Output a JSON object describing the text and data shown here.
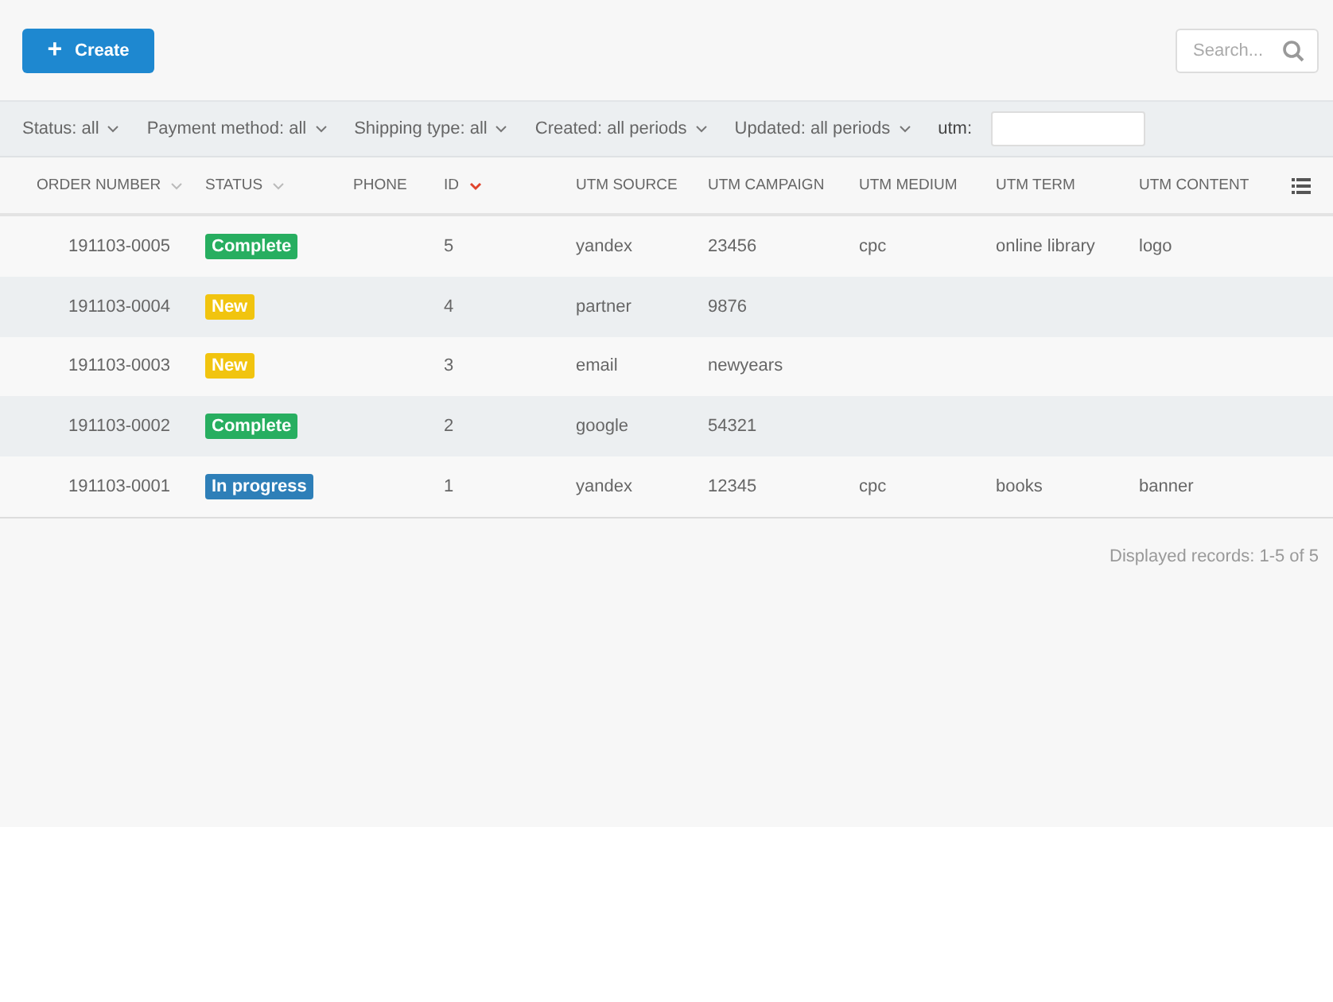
{
  "toolbar": {
    "create_button": {
      "icon": "+",
      "label": "Create"
    },
    "search": {
      "placeholder": "Search..."
    }
  },
  "filters": [
    {
      "label": "Status:",
      "value": "all",
      "kind": "dropdown"
    },
    {
      "label": "Payment method:",
      "value": "all",
      "kind": "dropdown"
    },
    {
      "label": "Shipping type:",
      "value": "all",
      "kind": "dropdown"
    },
    {
      "label": "Created:",
      "value": "all periods",
      "kind": "dropdown"
    },
    {
      "label": "Updated:",
      "value": "all periods",
      "kind": "dropdown"
    },
    {
      "label": "utm:",
      "kind": "input"
    }
  ],
  "table": {
    "columns": [
      {
        "label": "ORDER NUMBER",
        "kind": "sortable",
        "sorted": false
      },
      {
        "label": "STATUS",
        "kind": "sortable",
        "sorted": false
      },
      {
        "label": "PHONE",
        "kind": "plain"
      },
      {
        "label": "ID",
        "kind": "sortable",
        "sorted": true
      },
      {
        "label": "UTM SOURCE",
        "kind": "plain"
      },
      {
        "label": "UTM CAMPAIGN",
        "kind": "plain"
      },
      {
        "label": "UTM MEDIUM",
        "kind": "plain"
      },
      {
        "label": "UTM TERM",
        "kind": "plain"
      },
      {
        "label": "UTM CONTENT",
        "kind": "plain"
      }
    ],
    "rows": [
      {
        "order_number": "191103-0005",
        "status": {
          "label": "Complete",
          "color": "#27ae60"
        },
        "phone": "",
        "id": "5",
        "utm_source": "yandex",
        "utm_campaign": "23456",
        "utm_medium": "cpc",
        "utm_term": "online library",
        "utm_content": "logo"
      },
      {
        "order_number": "191103-0004",
        "status": {
          "label": "New",
          "color": "#f1c40f"
        },
        "phone": "",
        "id": "4",
        "utm_source": "partner",
        "utm_campaign": "9876",
        "utm_medium": "",
        "utm_term": "",
        "utm_content": ""
      },
      {
        "order_number": "191103-0003",
        "status": {
          "label": "New",
          "color": "#f1c40f"
        },
        "phone": "",
        "id": "3",
        "utm_source": "email",
        "utm_campaign": "newyears",
        "utm_medium": "",
        "utm_term": "",
        "utm_content": ""
      },
      {
        "order_number": "191103-0002",
        "status": {
          "label": "Complete",
          "color": "#27ae60"
        },
        "phone": "",
        "id": "2",
        "utm_source": "google",
        "utm_campaign": "54321",
        "utm_medium": "",
        "utm_term": "",
        "utm_content": ""
      },
      {
        "order_number": "191103-0001",
        "status": {
          "label": "In progress",
          "color": "#2e7fb8"
        },
        "phone": "",
        "id": "1",
        "utm_source": "yandex",
        "utm_campaign": "12345",
        "utm_medium": "cpc",
        "utm_term": "books",
        "utm_content": "banner"
      }
    ]
  },
  "footer": {
    "records": "Displayed records: 1-5 of 5"
  }
}
